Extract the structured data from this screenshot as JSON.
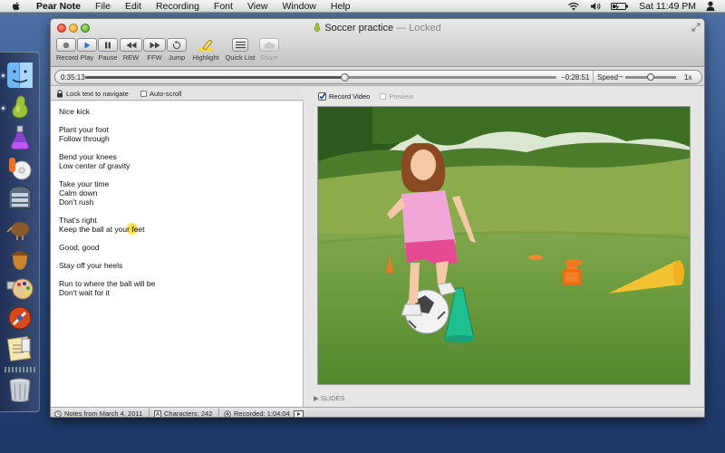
{
  "menubar": {
    "app_name": "Pear Note",
    "items": [
      "File",
      "Edit",
      "Recording",
      "Font",
      "View",
      "Window",
      "Help"
    ],
    "clock": "Sat 11:49 PM",
    "icons": [
      "apple-icon",
      "wifi-icon",
      "volume-icon",
      "battery-icon",
      "user-icon"
    ]
  },
  "dock": {
    "icons": [
      "finder-icon",
      "pear-note-icon",
      "potion-icon",
      "music-icon",
      "mail-icon",
      "kiwi-icon",
      "acorn-icon",
      "photos-icon",
      "rocket-icon",
      "notes-icon",
      "trash-icon"
    ]
  },
  "window": {
    "title": "Soccer practice",
    "title_status": "— Locked",
    "toolbar": {
      "record": "Record",
      "play": "Play",
      "pause": "Pause",
      "rew": "REW",
      "ffw": "FFW",
      "jump": "Jump",
      "highlight": "Highlight",
      "quick_list": "Quick List",
      "share": "Share"
    },
    "playback": {
      "elapsed": "0:35:13",
      "remaining": "−0:28:51",
      "progress": 0.55,
      "speed_label": "Speed",
      "speed_value": "1x",
      "speed_level": 0.5
    },
    "notes_header": {
      "lock_label": "Lock text to navigate",
      "autoscroll_label": "Auto-scroll"
    },
    "notes": [
      [
        "Nice kick"
      ],
      [
        "Plant your foot",
        "Follow through"
      ],
      [
        "Bend your knees",
        "Low center of gravity"
      ],
      [
        "Take your time",
        "Calm down",
        "Don't rush"
      ],
      [
        "That's right",
        "Keep the ball at your feet"
      ],
      [
        "Good, good"
      ],
      [
        "Stay off your heels"
      ],
      [
        "Run to where the ball will be",
        "Don't wait for it"
      ]
    ],
    "video": {
      "record_video_label": "Record Video",
      "preview_label": "Preview",
      "slides_label": "SLIDES"
    },
    "status": {
      "notes_date": "Notes from March 4, 2011",
      "characters": "Characters: 242",
      "recorded": "Recorded: 1:04:04"
    }
  }
}
